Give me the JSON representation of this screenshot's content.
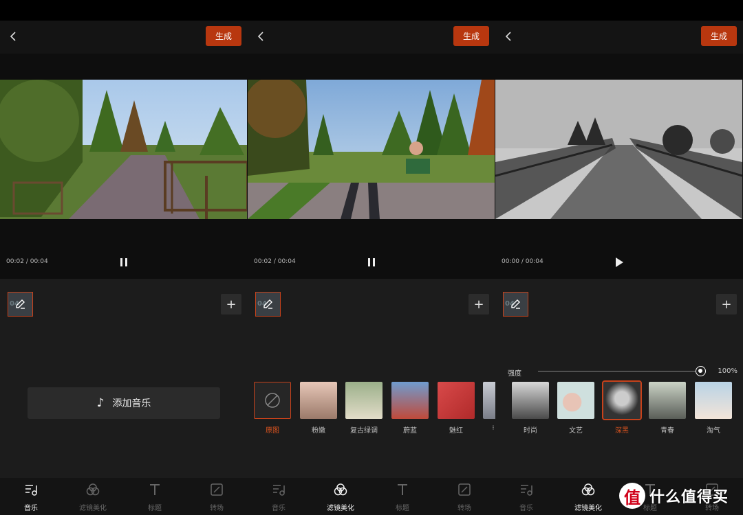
{
  "panels": [
    {
      "generate_label": "生成",
      "time_current": "00:02",
      "time_sep": "/",
      "time_total": "00:04",
      "playing": true,
      "clip_number": "04",
      "music": {
        "label": "添加音乐"
      }
    },
    {
      "generate_label": "生成",
      "time_current": "00:02",
      "time_sep": "/",
      "time_total": "00:04",
      "playing": true,
      "clip_number": "04",
      "filters": [
        "原图",
        "粉嫩",
        "复古绿调",
        "蔚蓝",
        "魅红",
        "⁝"
      ],
      "selected_filter": "原图"
    },
    {
      "generate_label": "生成",
      "time_current": "00:00",
      "time_sep": "/",
      "time_total": "00:04",
      "playing": false,
      "clip_number": "04",
      "strength": {
        "label": "强度",
        "value": "100%"
      },
      "filters": [
        "时尚",
        "文艺",
        "深黑",
        "青春",
        "淘气"
      ],
      "selected_filter": "深黑"
    }
  ],
  "tabs": [
    "音乐",
    "滤镜美化",
    "标题",
    "转场"
  ],
  "tabs_visible_p2": [
    "音乐",
    "滤镜美化",
    "标题",
    "转场"
  ],
  "active_tab": [
    "音乐",
    "滤镜美化",
    "滤镜美化"
  ],
  "watermark": {
    "logo": "值",
    "text": "什么值得买"
  },
  "colors": {
    "accent": "#b8370f",
    "active_text": "#e0551f",
    "bg": "#1c1c1c"
  }
}
